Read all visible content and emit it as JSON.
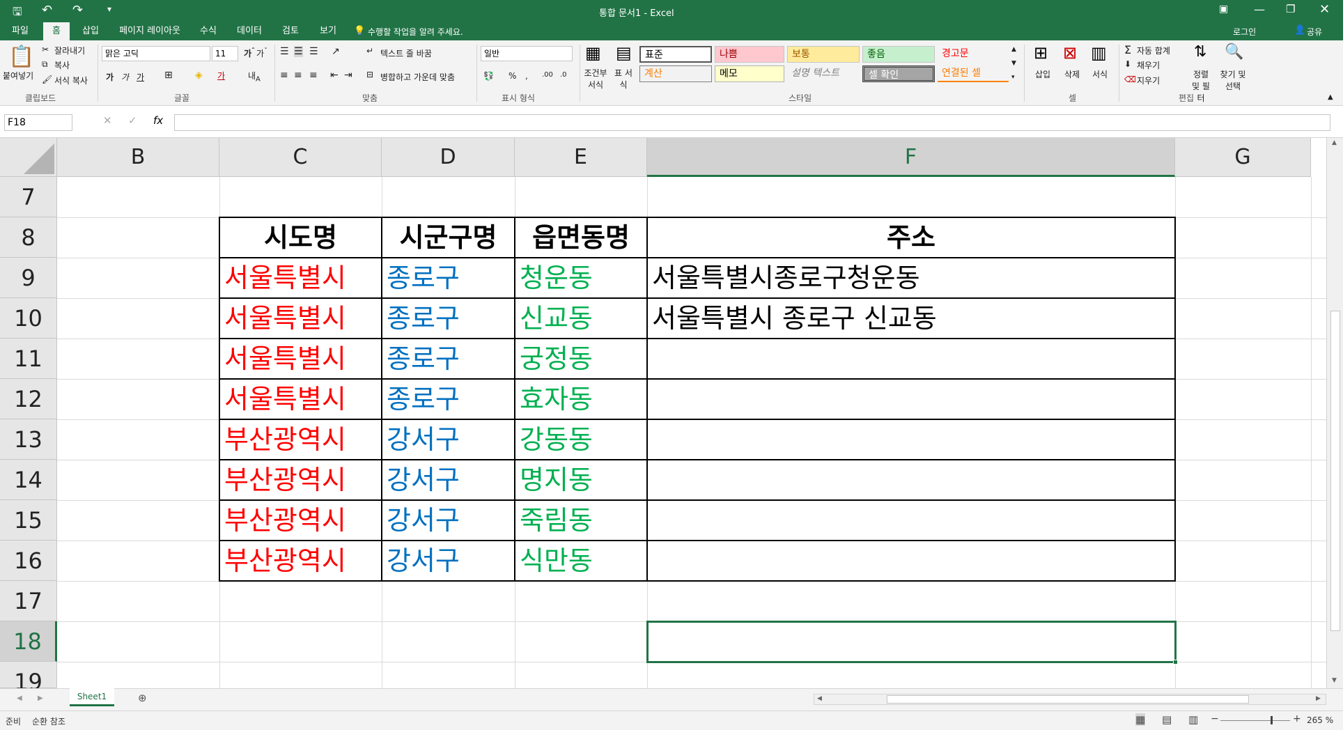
{
  "titlebar": {
    "title": "통합 문서1 - Excel"
  },
  "tabs": [
    {
      "label": "파일"
    },
    {
      "label": "홈"
    },
    {
      "label": "삽입"
    },
    {
      "label": "페이지 레이아웃"
    },
    {
      "label": "수식"
    },
    {
      "label": "데이터"
    },
    {
      "label": "검토"
    },
    {
      "label": "보기"
    }
  ],
  "tellme": "수행할 작업을 알려 주세요.",
  "account": {
    "login": "로그인",
    "share": "공유"
  },
  "ribbon": {
    "clipboard": {
      "paste": "붙여넣기",
      "cut": "잘라내기",
      "copy": "복사",
      "format_painter": "서식 복사",
      "group": "클립보드"
    },
    "font": {
      "name": "맑은 고딕",
      "size": "11",
      "group": "글꼴"
    },
    "alignment": {
      "wrap": "텍스트 줄 바꿈",
      "merge": "병합하고 가운데 맞춤",
      "group": "맞춤"
    },
    "number": {
      "format": "일반",
      "group": "표시 형식"
    },
    "styles": {
      "conditional": "조건부 서식",
      "table": "표 서식",
      "group": "스타일",
      "items": [
        "표준",
        "나쁨",
        "보통",
        "좋음",
        "경고문",
        "계산",
        "메모",
        "설명 텍스트",
        "셀 확인",
        "연결된 셀"
      ]
    },
    "cells": {
      "insert": "삽입",
      "delete": "삭제",
      "format": "서식",
      "group": "셀"
    },
    "editing": {
      "autosum": "자동 합계",
      "fill": "채우기",
      "clear": "지우기",
      "sort": "정렬 및 필터",
      "find": "찾기 및 선택",
      "group": "편집"
    }
  },
  "formula_bar": {
    "name_box": "F18",
    "formula": ""
  },
  "columns": [
    "B",
    "C",
    "D",
    "E",
    "F",
    "G"
  ],
  "rows": [
    "7",
    "8",
    "9",
    "10",
    "11",
    "12",
    "13",
    "14",
    "15",
    "16",
    "17",
    "18",
    "19"
  ],
  "table": {
    "headers": [
      "시도명",
      "시군구명",
      "읍면동명",
      "주소"
    ],
    "rows": [
      [
        "서울특별시",
        "종로구",
        "청운동",
        "서울특별시종로구청운동"
      ],
      [
        "서울특별시",
        "종로구",
        "신교동",
        "서울특별시 종로구 신교동"
      ],
      [
        "서울특별시",
        "종로구",
        "궁정동",
        ""
      ],
      [
        "서울특별시",
        "종로구",
        "효자동",
        ""
      ],
      [
        "부산광역시",
        "강서구",
        "강동동",
        ""
      ],
      [
        "부산광역시",
        "강서구",
        "명지동",
        ""
      ],
      [
        "부산광역시",
        "강서구",
        "죽림동",
        ""
      ],
      [
        "부산광역시",
        "강서구",
        "식만동",
        ""
      ]
    ]
  },
  "sheet_tab": "Sheet1",
  "status": {
    "ready": "준비",
    "circular": "순환 참조",
    "zoom": "265 %"
  },
  "colors": {
    "excel_green": "#217346",
    "sido": "#ff0000",
    "sigungu": "#0070c0",
    "eupmyeondong": "#00b050"
  }
}
